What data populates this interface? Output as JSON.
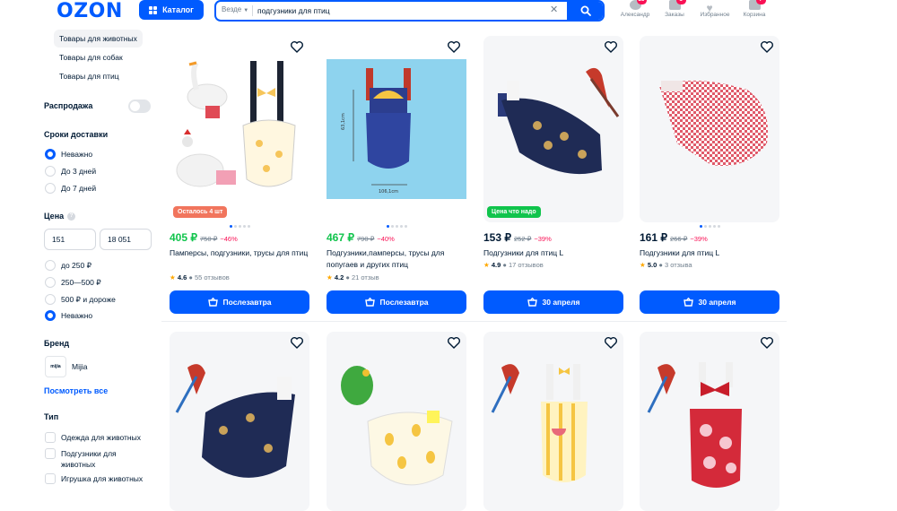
{
  "header": {
    "logo": "OZON",
    "catalog_label": "Каталог",
    "search_scope": "Везде",
    "search_value": "подгузники для птиц",
    "user_label": "Александр",
    "orders_label": "Заказы",
    "orders_count": "1",
    "favorites_label": "Избранное",
    "cart_label": "Корзина",
    "cart_count": "7",
    "user_badge": "25"
  },
  "sidebar": {
    "categories": [
      "Товары для животных",
      "Товары для собак",
      "Товары для птиц"
    ],
    "sale_label": "Распродажа",
    "delivery_title": "Сроки доставки",
    "delivery_options": [
      "Неважно",
      "До 3 дней",
      "До 7 дней"
    ],
    "price_title": "Цена",
    "price_from": "151",
    "price_to": "18 051",
    "price_options": [
      "до 250 ₽",
      "250—500 ₽",
      "500 ₽ и дороже",
      "Неважно"
    ],
    "brand_title": "Бренд",
    "brand_name": "Mijia",
    "brand_logo_text": "mijia",
    "see_all": "Посмотреть все",
    "type_title": "Тип",
    "type_options": [
      "Одежда для животных",
      "Подгузники для животных",
      "Игрушка для животных"
    ]
  },
  "products": [
    {
      "price": "405 ₽",
      "old": "750 ₽",
      "disc": "−46%",
      "title": "Памперсы, подгузники, трусы для птиц",
      "rating": "4.6",
      "reviews": "55 отзывов",
      "button": "Послезавтра",
      "badge": "Осталось 4 шт",
      "price_color": "#10c44c"
    },
    {
      "price": "467 ₽",
      "old": "790 ₽",
      "disc": "−40%",
      "title": "Подгузники,памперсы, трусы для попугаев и других птиц",
      "rating": "4.2",
      "reviews": "21 отзыв",
      "button": "Послезавтра",
      "badge": "",
      "price_color": "#10c44c"
    },
    {
      "price": "153 ₽",
      "old": "252 ₽",
      "disc": "−39%",
      "title": "Подгузники для птиц L",
      "rating": "4.9",
      "reviews": "17 отзывов",
      "button": "30 апреля",
      "badge": "Цена что надо",
      "price_color": "#001a34"
    },
    {
      "price": "161 ₽",
      "old": "266 ₽",
      "disc": "−39%",
      "title": "Подгузники для птиц L",
      "rating": "5.0",
      "reviews": "3 отзыва",
      "button": "30 апреля",
      "badge": "",
      "price_color": "#001a34"
    }
  ],
  "colors": {
    "accent": "#005bff",
    "discount": "#f91155",
    "green": "#10c44c",
    "badge_red": "#f1755d"
  },
  "dims_label": "63,1cm",
  "dims_label2": "106,1cm"
}
